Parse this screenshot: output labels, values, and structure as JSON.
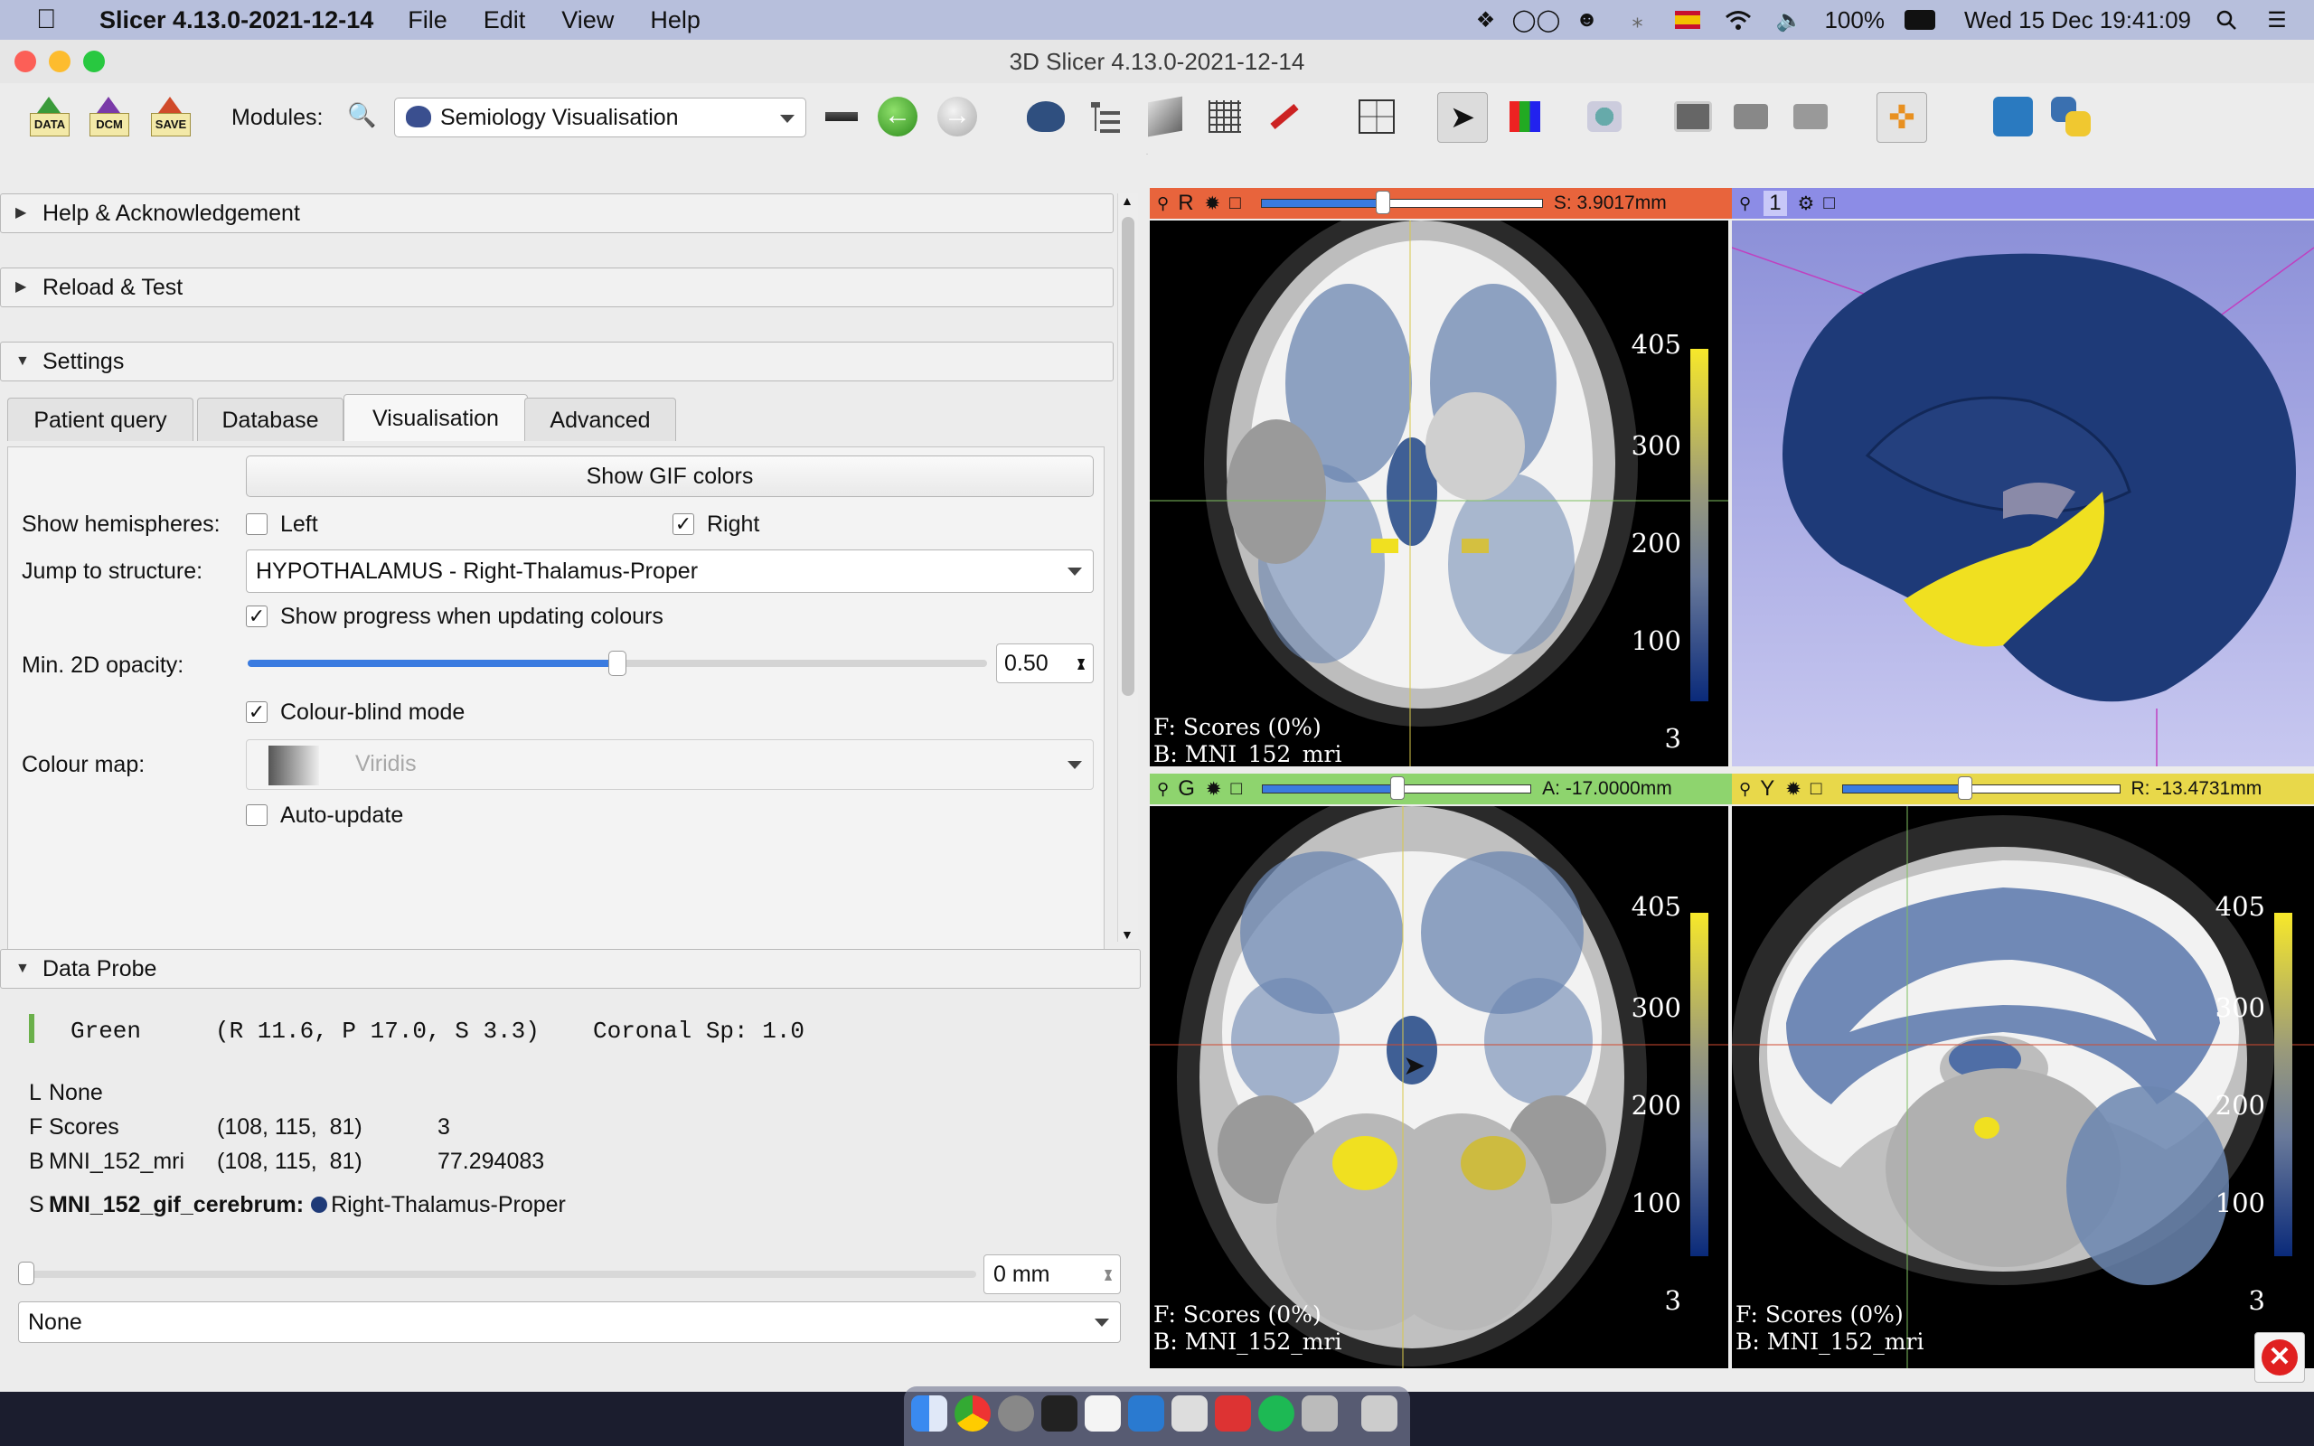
{
  "menubar": {
    "app_name": "Slicer 4.13.0-2021-12-14",
    "menus": [
      "File",
      "Edit",
      "View",
      "Help"
    ],
    "battery": "100%",
    "datetime": "Wed 15 Dec  19:41:09"
  },
  "window": {
    "title": "3D Slicer 4.13.0-2021-12-14"
  },
  "toolbar": {
    "data_label": "DATA",
    "dcm_label": "DCM",
    "save_label": "SAVE",
    "modules_label": "Modules:",
    "module_selected": "Semiology Visualisation"
  },
  "panel": {
    "help_section": "Help & Acknowledgement",
    "reload_section": "Reload & Test",
    "settings_section": "Settings",
    "tabs": [
      "Patient query",
      "Database",
      "Visualisation",
      "Advanced"
    ],
    "active_tab": "Visualisation",
    "show_gif_colors": "Show GIF colors",
    "show_hemispheres_label": "Show hemispheres:",
    "left_label": "Left",
    "right_label": "Right",
    "left_checked": false,
    "right_checked": true,
    "jump_label": "Jump to structure:",
    "jump_value": "HYPOTHALAMUS - Right-Thalamus-Proper",
    "show_progress_label": "Show progress when updating colours",
    "min_opacity_label": "Min. 2D opacity:",
    "min_opacity_value": "0.50",
    "min_opacity_fraction": 0.5,
    "colourblind_label": "Colour-blind mode",
    "colour_map_label": "Colour map:",
    "colour_map_value": "Viridis",
    "auto_update_label": "Auto-update"
  },
  "probe": {
    "section": "Data Probe",
    "view_name": "Green",
    "coords": "(R 11.6, P 17.0, S 3.3)",
    "orientation": "Coronal Sp: 1.0",
    "rows": [
      {
        "key": "L",
        "name": "None",
        "ijk": "",
        "value": ""
      },
      {
        "key": "F",
        "name": "Scores",
        "ijk": "(108, 115,  81)",
        "value": "3"
      },
      {
        "key": "B",
        "name": "MNI_152_mri",
        "ijk": "(108, 115,  81)",
        "value": "77.294083"
      }
    ],
    "segment_key": "S",
    "segment_name": "MNI_152_gif_cerebrum:",
    "segment_value": "Right-Thalamus-Proper",
    "slider_value": "0 mm",
    "bottom_select": "None"
  },
  "views": {
    "red": {
      "letter": "R",
      "offset": "S: 3.9017mm",
      "fg": "F: Scores (0%)",
      "bg": "B: MNI_152_mri",
      "slider_fraction": 0.43
    },
    "threed": {
      "letter": "1"
    },
    "green": {
      "letter": "G",
      "offset": "A: -17.0000mm",
      "fg": "F: Scores (0%)",
      "bg": "B: MNI_152_mri",
      "slider_fraction": 0.5
    },
    "yellow": {
      "letter": "Y",
      "offset": "R: -13.4731mm",
      "fg": "F: Scores (0%)",
      "bg": "B: MNI_152_mri",
      "slider_fraction": 0.44
    },
    "colorbar_ticks": [
      "405",
      "300",
      "200",
      "100",
      "3"
    ]
  },
  "colors": {
    "red_bar": "#e8643c",
    "green_bar": "#8ed46e",
    "yellow_bar": "#e8d84a",
    "threed_bar": "#8c8ce6",
    "navy": "#1e3a78",
    "yellow_score": "#f0e020"
  }
}
